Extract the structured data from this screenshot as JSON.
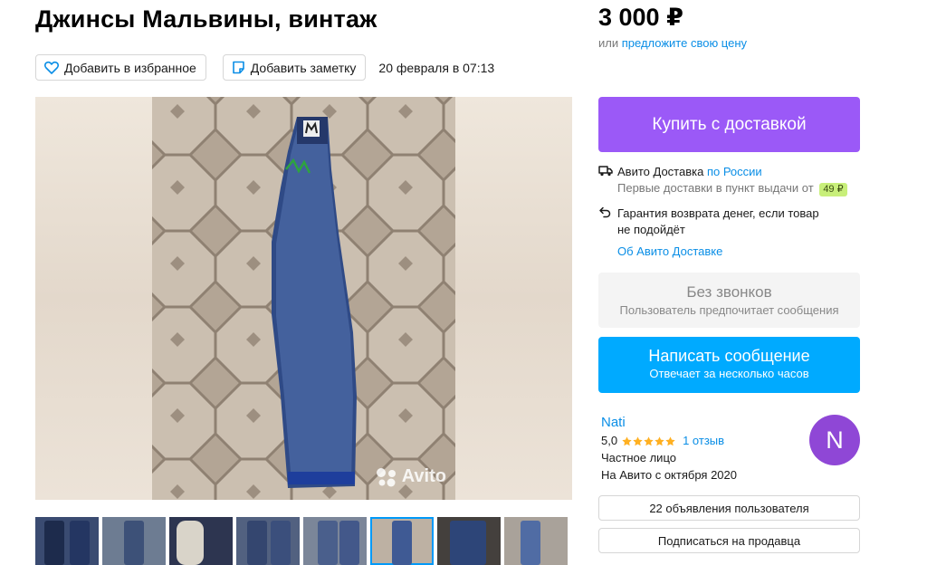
{
  "listing": {
    "title": "Джинсы Мальвины, винтаж",
    "date": "20 февраля в 07:13",
    "favorite_label": "Добавить в избранное",
    "note_label": "Добавить заметку"
  },
  "gallery": {
    "watermark": "Avito",
    "thumbnails_count": 8,
    "active_thumbnail": 6
  },
  "price": {
    "value": "3 000 ₽",
    "alt_prefix": "или",
    "alt_link": "предложите свою цену"
  },
  "buy": {
    "label": "Купить с доставкой"
  },
  "delivery": {
    "service": "Авито Доставка",
    "region": "по России",
    "first_delivery": "Первые доставки в пункт выдачи от",
    "first_delivery_price": "49 ₽",
    "guarantee_line1": "Гарантия возврата денег, если товар",
    "guarantee_line2": "не подойдёт",
    "about_link": "Об Авито Доставке"
  },
  "contact": {
    "no_calls_title": "Без звонков",
    "no_calls_subtitle": "Пользователь предпочитает сообщения",
    "message_label": "Написать сообщение",
    "message_subtitle": "Отвечает за несколько часов"
  },
  "seller": {
    "name": "Nati",
    "rating": "5,0",
    "stars": 5,
    "reviews": "1 отзыв",
    "type": "Частное лицо",
    "since": "На Авито с октября 2020",
    "avatar_letter": "N",
    "avatar_color": "#8f47d6",
    "ads_button": "22 объявления пользователя",
    "subscribe_button": "Подписаться на продавца"
  },
  "colors": {
    "buy_button": "#9b59f7",
    "message_button": "#00aaff",
    "link": "#0a8ee6",
    "star": "#ffb021"
  }
}
